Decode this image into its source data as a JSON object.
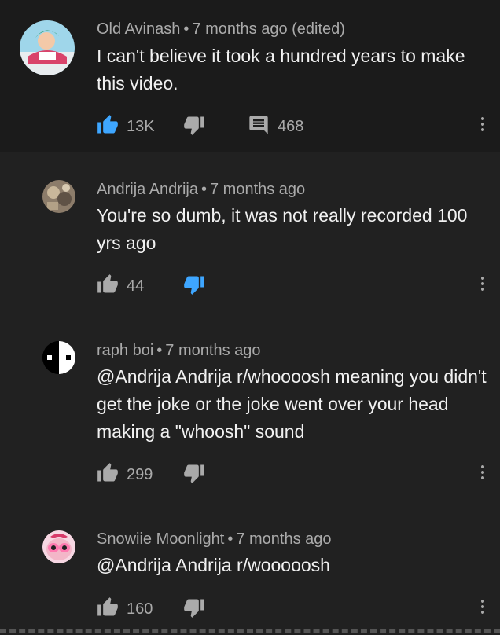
{
  "comments": [
    {
      "author": "Old Avinash",
      "time": "7 months ago (edited)",
      "text": "I can't believe it took a hundred years to make this video.",
      "likes": "13K",
      "replies": "468",
      "liked": true,
      "disliked": false
    },
    {
      "author": "Andrija Andrija",
      "time": "7 months ago",
      "text": "You're so dumb, it was not really recorded 100 yrs ago",
      "likes": "44",
      "liked": false,
      "disliked": true
    },
    {
      "author": "raph boi",
      "time": "7 months ago",
      "text": "@Andrija Andrija r/whoooosh meaning you didn't get the joke or the joke went over your head making a \"whoosh\" sound",
      "likes": "299",
      "liked": false,
      "disliked": false
    },
    {
      "author": "Snowiie Moonlight",
      "time": "7 months ago",
      "text": "@Andrija Andrija r/wooooosh",
      "likes": "160",
      "liked": false,
      "disliked": false
    }
  ],
  "separator": "•",
  "colors": {
    "background": "#212121",
    "highlight_background": "#1b1b1b",
    "accent_blue": "#3ea6ff",
    "icon_gray": "#aaaaaa",
    "text": "#f1f1f1"
  },
  "icons": {
    "like": "thumb-up-icon",
    "dislike": "thumb-down-icon",
    "reply": "comment-icon",
    "more": "more-vert-icon"
  }
}
